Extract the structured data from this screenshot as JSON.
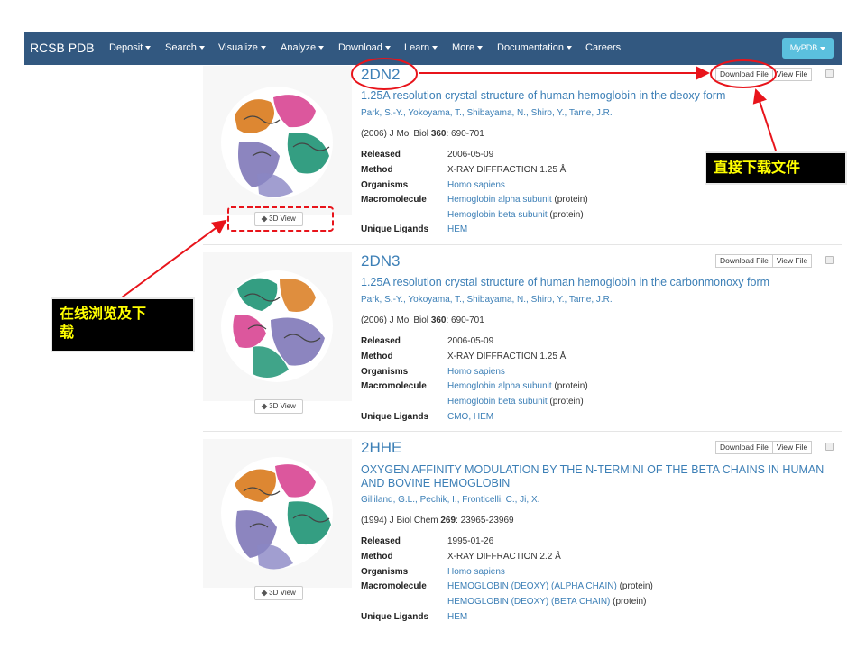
{
  "navbar": {
    "brand": "RCSB PDB",
    "items": [
      "Deposit",
      "Search",
      "Visualize",
      "Analyze",
      "Download",
      "Learn",
      "More",
      "Documentation",
      "Careers"
    ],
    "mypdb": "MyPDB"
  },
  "labels": {
    "released": "Released",
    "method": "Method",
    "organisms": "Organisms",
    "macromolecule": "Macromolecule",
    "ligands": "Unique Ligands",
    "download_file": "Download File",
    "view_file": "View File",
    "view3d": "3D View"
  },
  "entries": [
    {
      "id": "2DN2",
      "title": "1.25A resolution crystal structure of human hemoglobin in the deoxy form",
      "authors": "Park, S.-Y., Yokoyama, T., Shibayama, N., Shiro, Y., Tame, J.R.",
      "cite_pre": "(2006) J Mol Biol ",
      "cite_vol": "360",
      "cite_post": ": 690-701",
      "released": "2006-05-09",
      "method": "X-RAY DIFFRACTION 1.25 Å",
      "organism": "Homo sapiens",
      "macro": [
        {
          "name": "Hemoglobin alpha subunit",
          "type": " (protein)"
        },
        {
          "name": "Hemoglobin beta subunit",
          "type": " (protein)"
        }
      ],
      "ligands": "HEM"
    },
    {
      "id": "2DN3",
      "title": "1.25A resolution crystal structure of human hemoglobin in the carbonmonoxy form",
      "authors": "Park, S.-Y., Yokoyama, T., Shibayama, N., Shiro, Y., Tame, J.R.",
      "cite_pre": "(2006) J Mol Biol ",
      "cite_vol": "360",
      "cite_post": ": 690-701",
      "released": "2006-05-09",
      "method": "X-RAY DIFFRACTION 1.25 Å",
      "organism": "Homo sapiens",
      "macro": [
        {
          "name": "Hemoglobin alpha subunit",
          "type": " (protein)"
        },
        {
          "name": "Hemoglobin beta subunit",
          "type": " (protein)"
        }
      ],
      "ligands": "CMO, HEM"
    },
    {
      "id": "2HHE",
      "title": "OXYGEN AFFINITY MODULATION BY THE N-TERMINI OF THE BETA CHAINS IN HUMAN AND BOVINE HEMOGLOBIN",
      "authors": "Gilliland, G.L., Pechik, I., Fronticelli, C., Ji, X.",
      "cite_pre": "(1994) J Biol Chem ",
      "cite_vol": "269",
      "cite_post": ": 23965-23969",
      "released": "1995-01-26",
      "method": "X-RAY DIFFRACTION 2.2 Å",
      "organism": "Homo sapiens",
      "macro": [
        {
          "name": "HEMOGLOBIN (DEOXY) (ALPHA CHAIN)",
          "type": " (protein)"
        },
        {
          "name": "HEMOGLOBIN (DEOXY) (BETA CHAIN)",
          "type": " (protein)"
        }
      ],
      "ligands": "HEM"
    }
  ],
  "annotations": {
    "download_callout": "直接下载文件",
    "browse_callout_line1": "在线浏览及下",
    "browse_callout_line2": "载"
  },
  "colors": {
    "navbar": "#325880",
    "link": "#3c7fb6",
    "callout_text": "#ffff00",
    "annotation_red": "#e8141b"
  }
}
